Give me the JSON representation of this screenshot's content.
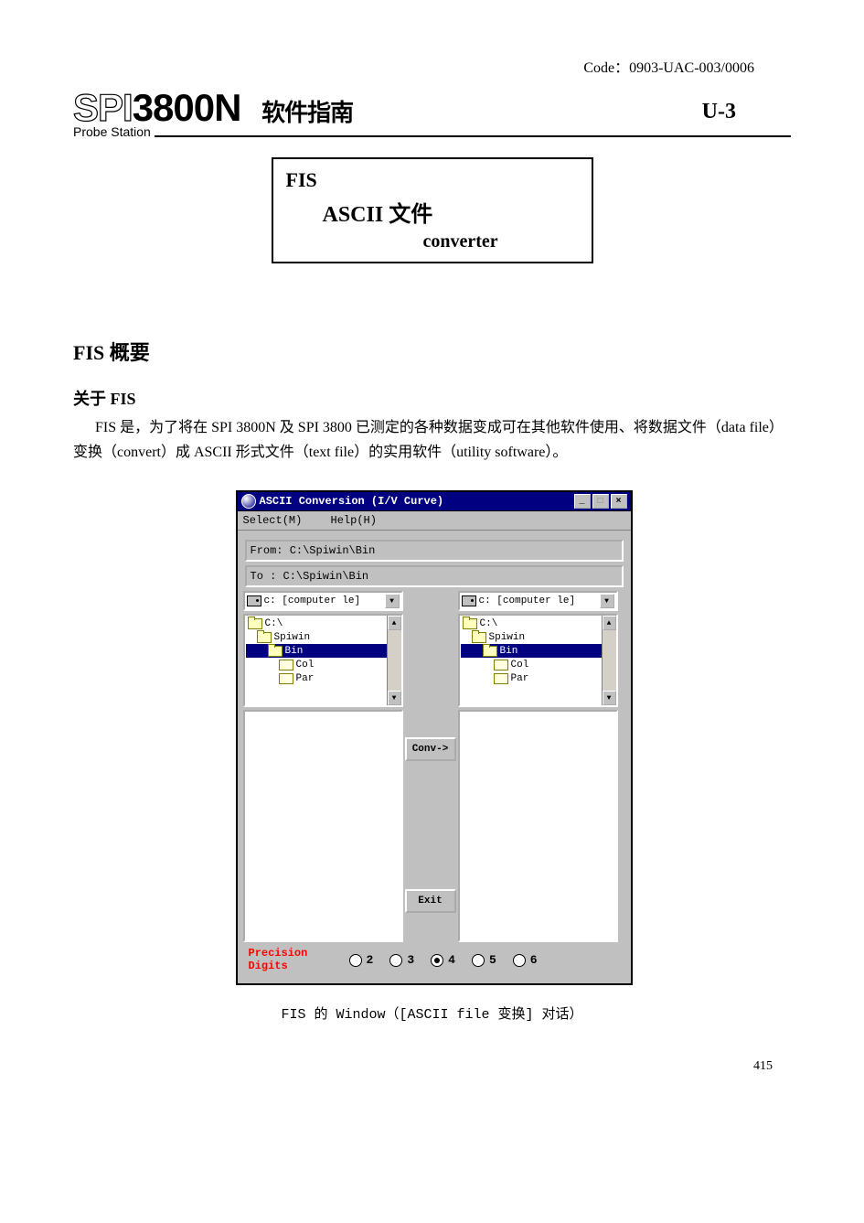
{
  "code_line": "Code：0903-UAC-003/0006",
  "header": {
    "logo_spi": "SPI",
    "logo_model": "3800N",
    "logo_subtitle": "软件指南",
    "probe_station": "Probe Station",
    "section_id": "U-3"
  },
  "title_box": {
    "line1": "FIS",
    "line2": "ASCII 文件",
    "line3": "converter"
  },
  "section_heading": "FIS 概要",
  "sub_heading": "关于 FIS",
  "paragraph": "FIS 是，为了将在 SPI 3800N 及 SPI 3800 已测定的各种数据变成可在其他软件使用、将数据文件（data file）变换（convert）成 ASCII 形式文件（text file）的实用软件（utility software）。",
  "dialog": {
    "title": "ASCII Conversion (I/V Curve)",
    "menu_select": "Select(M)",
    "menu_help": "Help(H)",
    "from_label": "From: C:\\Spiwin\\Bin",
    "to_label": "To  : C:\\Spiwin\\Bin",
    "drive_text": "c: [computer le]",
    "dirs": [
      {
        "name": "C:\\",
        "indent": 0,
        "open": true
      },
      {
        "name": "Spiwin",
        "indent": 1,
        "open": true
      },
      {
        "name": "Bin",
        "indent": 2,
        "open": true,
        "selected": true
      },
      {
        "name": "Col",
        "indent": 3,
        "open": false
      },
      {
        "name": "Par",
        "indent": 3,
        "open": false
      }
    ],
    "conv_btn": "Conv->",
    "exit_btn": "Exit",
    "precision_label1": "Precision",
    "precision_label2": "Digits",
    "radios": [
      "2",
      "3",
      "4",
      "5",
      "6"
    ],
    "radio_checked": "4"
  },
  "caption": "FIS 的 Window（[ASCII file 变换] 对话）",
  "page_number": "415"
}
